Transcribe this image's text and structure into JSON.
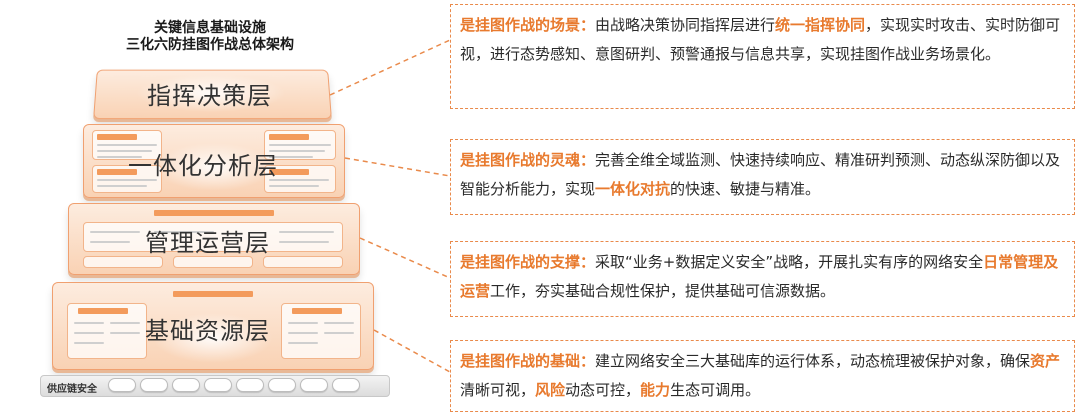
{
  "diagram": {
    "title_line1": "关键信息基础设施",
    "title_line2": "三化六防挂图作战总体架构",
    "layers": [
      {
        "name": "指挥决策层"
      },
      {
        "name": "一体化分析层"
      },
      {
        "name": "管理运营层"
      },
      {
        "name": "基础资源层"
      }
    ],
    "footer_label": "供应链安全"
  },
  "descriptions": [
    {
      "title": "是挂图作战的场景：",
      "parts": [
        "由战略决策协同指挥层进行",
        "统一指挥协同",
        "，实现实时攻击、实时防御可视，进行态势感知、意图研判、预警通报与信息共享，实现挂图作战业务场景化。"
      ]
    },
    {
      "title": "是挂图作战的灵魂：",
      "parts": [
        "完善全维全域监测、快速持续响应、精准研判预测、动态纵深防御以及智能分析能力，实现",
        "一体化对抗",
        "的快速、敏捷与精准。"
      ]
    },
    {
      "title": "是挂图作战的支撑：",
      "parts": [
        "采取“业务+数据定义安全”战略，开展扎实有序的网络安全",
        "日常管理及运营",
        "工作，夯实基础合规性保护，提供基础可信源数据。"
      ]
    },
    {
      "title": "是挂图作战的基础：",
      "parts": [
        "建立网络安全三大基础库的运行体系，动态梳理被保护对象，确保",
        "资产",
        "清晰可视，",
        "风险",
        "动态可控，",
        "能力",
        "生态可调用。"
      ]
    }
  ],
  "colors": {
    "accent": "#e87a2e",
    "dash": "#e98a4b",
    "layer_fill": "#f9d2b4"
  }
}
